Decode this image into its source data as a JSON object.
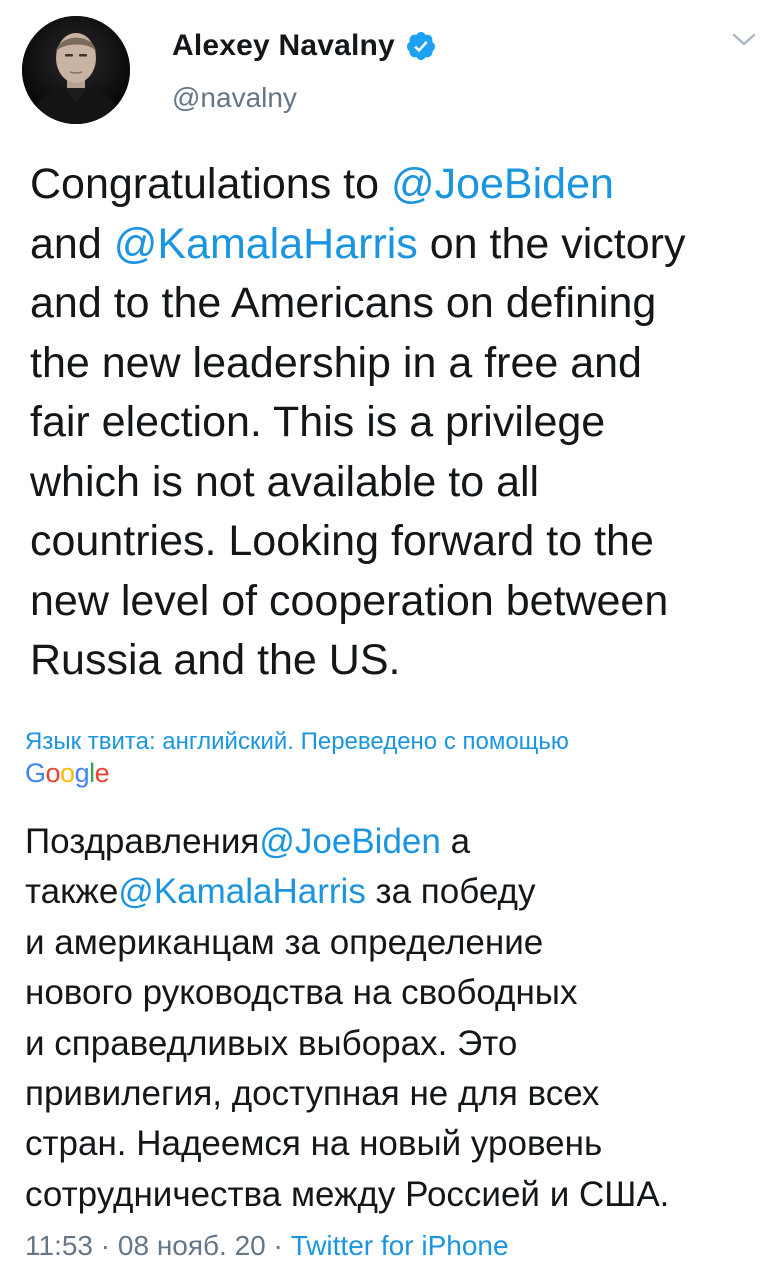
{
  "header": {
    "display_name": "Alexey Navalny",
    "handle": "@navalny",
    "avatar_icon": "profile-photo",
    "verified_icon": "verified-badge-icon",
    "menu_icon": "chevron-down-icon"
  },
  "tweet": {
    "lines": [
      [
        {
          "text": "Congratulations to "
        },
        {
          "text": "@JoeBiden",
          "link": true
        }
      ],
      [
        {
          "text": "and "
        },
        {
          "text": "@KamalaHarris",
          "link": true
        },
        {
          "text": " on the victory"
        }
      ],
      [
        {
          "text": "and to the Americans on defining"
        }
      ],
      [
        {
          "text": "the new leadership in a free and"
        }
      ],
      [
        {
          "text": "fair election. This is a privilege"
        }
      ],
      [
        {
          "text": "which is not available to all"
        }
      ],
      [
        {
          "text": "countries. Looking forward to the"
        }
      ],
      [
        {
          "text": "new level of cooperation between"
        }
      ],
      [
        {
          "text": "Russia and the US."
        }
      ]
    ]
  },
  "translation": {
    "info": "Язык твита: английский. Переведено с помощью",
    "provider": [
      "G",
      "o",
      "o",
      "g",
      "l",
      "e"
    ],
    "lines": [
      [
        {
          "text": "Поздравления"
        },
        {
          "text": "@JoeBiden",
          "link": true
        },
        {
          "text": " а"
        }
      ],
      [
        {
          "text": "также"
        },
        {
          "text": "@KamalaHarris",
          "link": true
        },
        {
          "text": " за победу"
        }
      ],
      [
        {
          "text": "и американцам за определение"
        }
      ],
      [
        {
          "text": "нового руководства на свободных"
        }
      ],
      [
        {
          "text": "и справедливых выборах. Это"
        }
      ],
      [
        {
          "text": "привилегия, доступная не для всех"
        }
      ],
      [
        {
          "text": "стран. Надеемся на новый уровень"
        }
      ],
      [
        {
          "text": "сотрудничества между Россией и США."
        }
      ]
    ]
  },
  "footer": {
    "time": "11:53",
    "separator1": " · ",
    "date": "08 нояб. 20",
    "separator2": " · ",
    "source": "Twitter for iPhone"
  },
  "colors": {
    "link": "#1b95e0",
    "text": "#14171a",
    "muted": "#657786",
    "verified": "#1da1f2"
  }
}
